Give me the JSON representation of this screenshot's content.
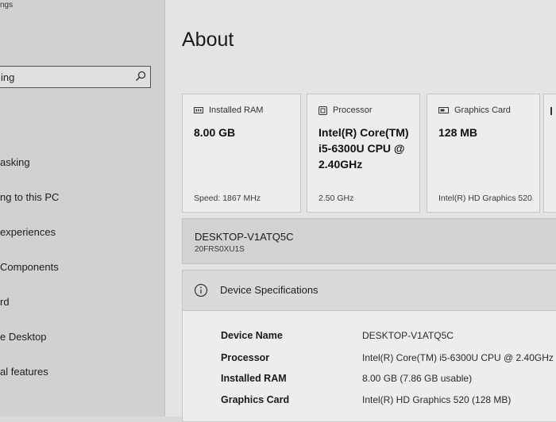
{
  "window": {
    "title": "ngs"
  },
  "sidebar": {
    "search_text": "ing",
    "items": [
      {
        "label": "asking"
      },
      {
        "label": "ng to this PC"
      },
      {
        "label": "experiences"
      },
      {
        "label": "Components"
      },
      {
        "label": "rd"
      },
      {
        "label": "e Desktop"
      },
      {
        "label": "al features"
      }
    ]
  },
  "main": {
    "title": "About",
    "cards": [
      {
        "icon": "ram-icon",
        "header": "Installed RAM",
        "value": "8.00 GB",
        "footer": "Speed: 1867 MHz"
      },
      {
        "icon": "processor-icon",
        "header": "Processor",
        "value_lines": [
          "Intel(R) Core(TM)",
          "i5-6300U CPU @",
          "2.40GHz"
        ],
        "footer": "2.50 GHz"
      },
      {
        "icon": "graphics-card-icon",
        "header": "Graphics Card",
        "value": "128 MB",
        "footer": "Intel(R) HD Graphics 520"
      }
    ],
    "device": {
      "name": "DESKTOP-V1ATQ5C",
      "model": "20FRS0XU1S"
    },
    "specifications": {
      "title": "Device Specifications",
      "rows": [
        {
          "label": "Device Name",
          "value": "DESKTOP-V1ATQ5C"
        },
        {
          "label": "Processor",
          "value": "Intel(R) Core(TM) i5-6300U CPU @ 2.40GHz"
        },
        {
          "label": "Installed RAM",
          "value": "8.00 GB (7.86 GB usable)"
        },
        {
          "label": "Graphics Card",
          "value": "Intel(R) HD Graphics 520 (128 MB)"
        }
      ]
    }
  }
}
